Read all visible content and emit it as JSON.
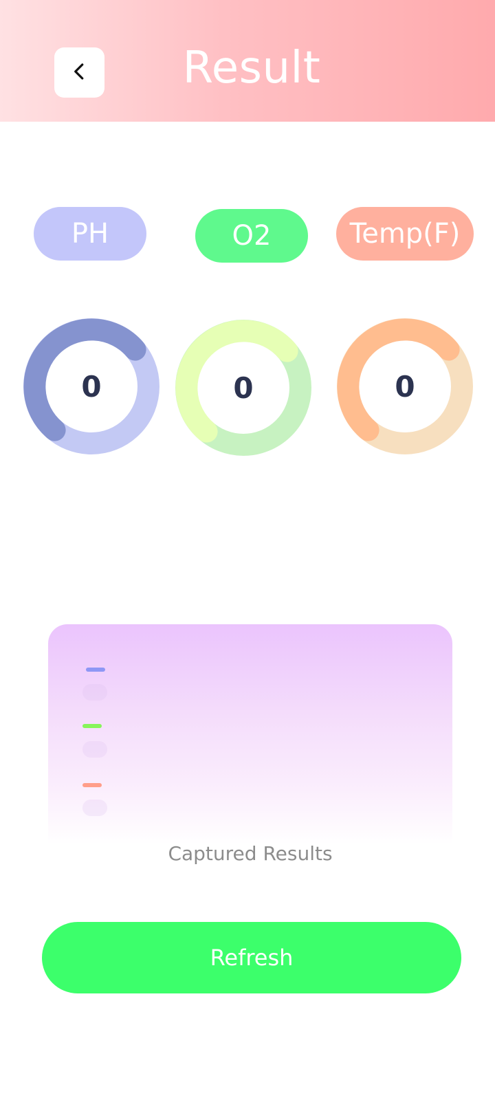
{
  "header": {
    "title": "Result",
    "back_icon": "chevron-left-icon"
  },
  "pills": {
    "ph": "PH",
    "o2": "O2",
    "temp": "Temp(F)"
  },
  "gauges": [
    {
      "name": "ph",
      "value": "0",
      "track_color": "#c3c9f4",
      "arc_color": "#8593cf"
    },
    {
      "name": "o2",
      "value": "0",
      "track_color": "#c7f2c1",
      "arc_color": "#e6ffb5"
    },
    {
      "name": "temp",
      "value": "0",
      "track_color": "#f7dfbf",
      "arc_color": "#ffbd8f"
    }
  ],
  "captured_card": {
    "caption": "Captured Results",
    "legend_colors": [
      "#8e97f5",
      "#86f55a",
      "#ff9e8a"
    ]
  },
  "actions": {
    "refresh_label": "Refresh"
  },
  "colors": {
    "header_gradient_start": "#ffe1e3",
    "header_gradient_end": "#ffaaad",
    "ph_pill": "#c3c6fa",
    "o2_pill": "#5ff98d",
    "temp_pill": "#ffb09e",
    "refresh_button": "#3cff6b"
  }
}
